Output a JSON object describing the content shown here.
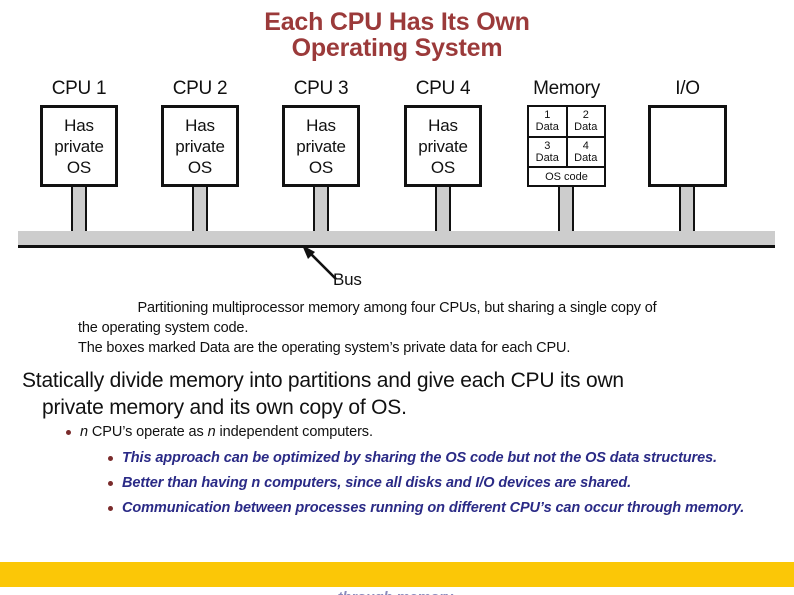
{
  "slide": {
    "title_line1": "Each CPU Has Its Own",
    "title_line2": "Operating System",
    "title_color": "#9b3a3a"
  },
  "diagram": {
    "cpus": [
      {
        "label": "CPU 1",
        "text_line1": "Has",
        "text_line2": "private",
        "text_line3": "OS"
      },
      {
        "label": "CPU 2",
        "text_line1": "Has",
        "text_line2": "private",
        "text_line3": "OS"
      },
      {
        "label": "CPU 3",
        "text_line1": "Has",
        "text_line2": "private",
        "text_line3": "OS"
      },
      {
        "label": "CPU 4",
        "text_line1": "Has",
        "text_line2": "private",
        "text_line3": "OS"
      }
    ],
    "memory": {
      "label": "Memory",
      "cells": [
        {
          "number": "1",
          "text": "Data"
        },
        {
          "number": "2",
          "text": "Data"
        },
        {
          "number": "3",
          "text": "Data"
        },
        {
          "number": "4",
          "text": "Data"
        }
      ],
      "os_code": "OS code"
    },
    "io": {
      "label": "I/O"
    },
    "bus": {
      "label": "Bus",
      "color": "#cdcdcd"
    }
  },
  "caption": {
    "line1": "Partitioning multiprocessor memory among four CPUs, but sharing a single copy of",
    "line2": "the operating system code.",
    "line3": "The boxes marked Data are the operating system’s private data for each CPU."
  },
  "body": {
    "headline_line1": "Statically divide memory into partitions and give each CPU its own",
    "headline_line2": "private memory and its own copy of OS.",
    "bullets": [
      {
        "level": 1,
        "text_before_italic": "",
        "italic1": "n",
        "text_mid": " CPU’s operate as ",
        "italic2": "n",
        "text_after": " independent computers."
      },
      {
        "level": 2,
        "text": "This approach can be optimized by sharing the OS code but not the OS data structures."
      },
      {
        "level": 2,
        "text": "Better than having n computers, since all disks and I/O devices are shared."
      },
      {
        "level": 2,
        "text": "Communication between processes running on different CPU’s can occur through memory."
      }
    ],
    "bullet_color": "#2a2a86",
    "bullet_marker_color": "#7a2b2b"
  },
  "footer": {
    "bar_color": "#fbc707",
    "clipped_text": "through memory."
  }
}
